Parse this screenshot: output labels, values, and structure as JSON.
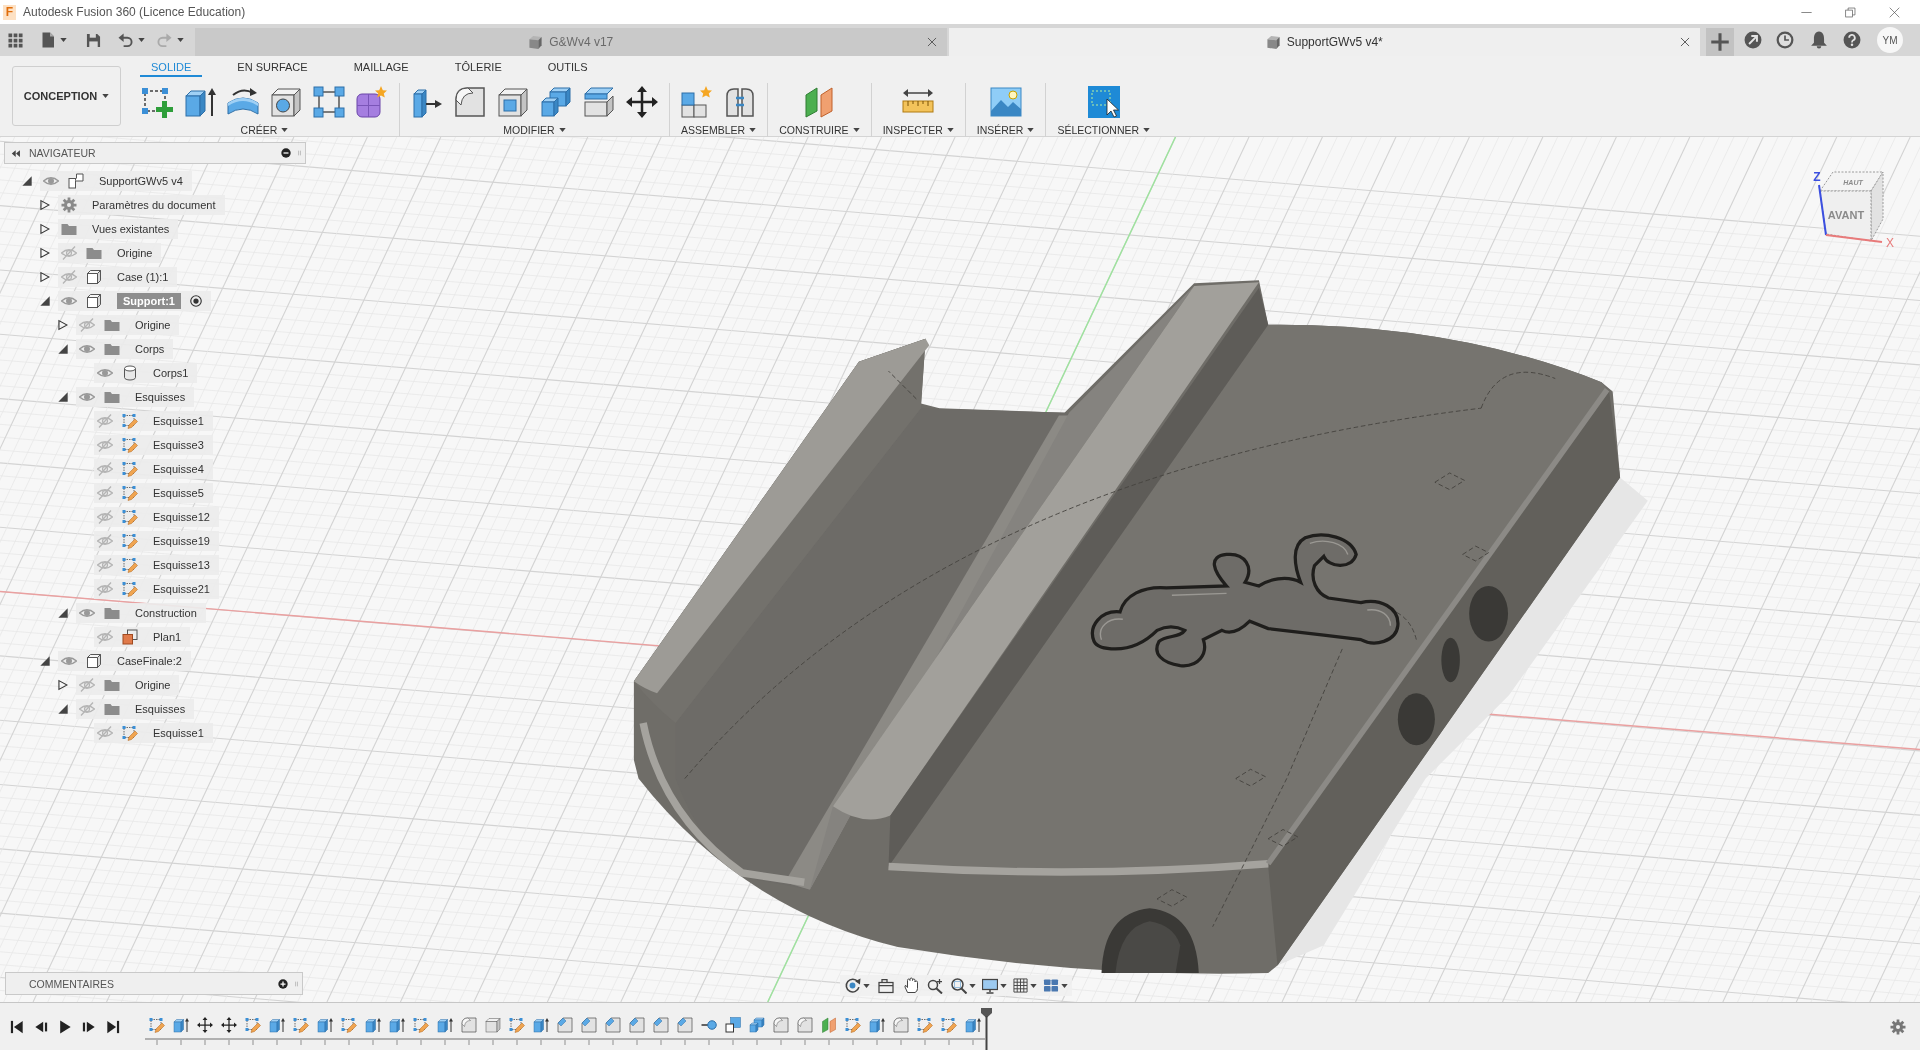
{
  "window": {
    "logo": "F",
    "title": "Autodesk Fusion 360 (Licence Education)"
  },
  "document_tabs": [
    {
      "label": "G&Wv4 v17",
      "selected": false
    },
    {
      "label": "SupportGWv5 v4*",
      "selected": true
    }
  ],
  "account": {
    "initials": "YM"
  },
  "toolbar": {
    "workspace": "CONCEPTION",
    "tabs": [
      {
        "label": "SOLIDE",
        "selected": true
      },
      {
        "label": "EN SURFACE",
        "selected": false
      },
      {
        "label": "MAILLAGE",
        "selected": false
      },
      {
        "label": "TÔLERIE",
        "selected": false
      },
      {
        "label": "OUTILS",
        "selected": false
      }
    ],
    "groups": [
      "CRÉER",
      "MODIFIER",
      "ASSEMBLER",
      "CONSTRUIRE",
      "INSPECTER",
      "INSÉRER",
      "SÉLECTIONNER"
    ]
  },
  "navigator": {
    "title": "NAVIGATEUR",
    "tree": [
      {
        "label": "SupportGWv5 v4",
        "kind": "root",
        "visible": true,
        "expanded": true,
        "children": [
          {
            "label": "Paramètres du document",
            "kind": "settings",
            "expanded": false
          },
          {
            "label": "Vues existantes",
            "kind": "folder",
            "expanded": false
          },
          {
            "label": "Origine",
            "kind": "folder",
            "visible": false,
            "expanded": false
          },
          {
            "label": "Case (1):1",
            "kind": "component",
            "visible": false,
            "expanded": false,
            "active": false
          },
          {
            "label": "Support:1",
            "kind": "component",
            "visible": true,
            "expanded": true,
            "active": true,
            "children": [
              {
                "label": "Origine",
                "kind": "folder",
                "visible": false,
                "expanded": false
              },
              {
                "label": "Corps",
                "kind": "folder",
                "visible": true,
                "expanded": true,
                "children": [
                  {
                    "label": "Corps1",
                    "kind": "body",
                    "visible": true
                  }
                ]
              },
              {
                "label": "Esquisses",
                "kind": "folder",
                "visible": true,
                "expanded": true,
                "children": [
                  {
                    "label": "Esquisse1",
                    "kind": "sketch",
                    "visible": false
                  },
                  {
                    "label": "Esquisse3",
                    "kind": "sketch",
                    "visible": false
                  },
                  {
                    "label": "Esquisse4",
                    "kind": "sketch",
                    "visible": false
                  },
                  {
                    "label": "Esquisse5",
                    "kind": "sketch",
                    "visible": false
                  },
                  {
                    "label": "Esquisse12",
                    "kind": "sketch",
                    "visible": false
                  },
                  {
                    "label": "Esquisse19",
                    "kind": "sketch",
                    "visible": false
                  },
                  {
                    "label": "Esquisse13",
                    "kind": "sketch",
                    "visible": false
                  },
                  {
                    "label": "Esquisse21",
                    "kind": "sketch",
                    "visible": false
                  }
                ]
              },
              {
                "label": "Construction",
                "kind": "folder",
                "visible": true,
                "expanded": true,
                "children": [
                  {
                    "label": "Plan1",
                    "kind": "plane",
                    "visible": false
                  }
                ]
              }
            ]
          },
          {
            "label": "CaseFinale:2",
            "kind": "component",
            "visible": true,
            "expanded": true,
            "active": false,
            "children": [
              {
                "label": "Origine",
                "kind": "folder",
                "visible": false,
                "expanded": false
              },
              {
                "label": "Esquisses",
                "kind": "folder",
                "visible": false,
                "expanded": true,
                "children": [
                  {
                    "label": "Esquisse1",
                    "kind": "sketch",
                    "visible": false
                  }
                ]
              }
            ]
          }
        ]
      }
    ]
  },
  "view_cube": {
    "top_face": "HAUT",
    "front_face": "AVANT",
    "z_axis": "Z",
    "x_axis": "X"
  },
  "comments": {
    "title": "COMMENTAIRES"
  }
}
